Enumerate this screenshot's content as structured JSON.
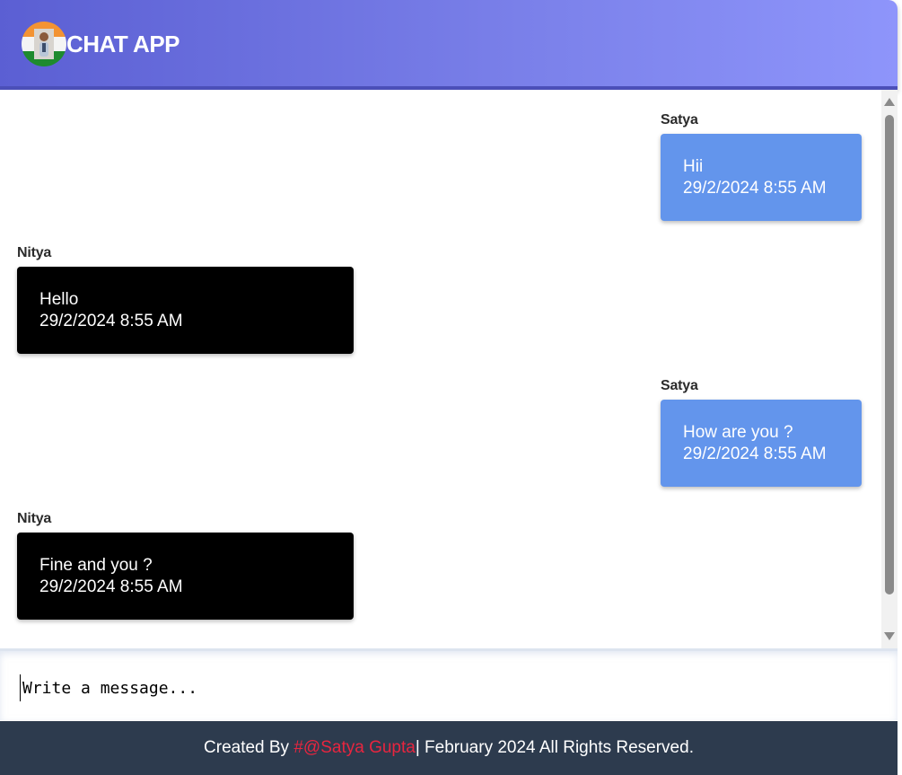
{
  "header": {
    "title": "CHAT APP",
    "avatar_icon": "user-avatar-flag-icon"
  },
  "messages": [
    {
      "sender": "Satya",
      "text": "Hii",
      "time": "29/2/2024 8:55 AM",
      "direction": "outgoing"
    },
    {
      "sender": "Nitya",
      "text": "Hello",
      "time": "29/2/2024 8:55 AM",
      "direction": "incoming"
    },
    {
      "sender": "Satya",
      "text": "How are you ?",
      "time": "29/2/2024 8:55 AM",
      "direction": "outgoing"
    },
    {
      "sender": "Nitya",
      "text": "Fine and you ?",
      "time": "29/2/2024 8:55 AM",
      "direction": "incoming"
    }
  ],
  "composer": {
    "placeholder": "Write a message...",
    "value": ""
  },
  "footer": {
    "prefix": "Created By ",
    "link_text": "#@Satya Gupta",
    "suffix": "| February 2024 All Rights Reserved."
  },
  "colors": {
    "header_start": "#5b5fd3",
    "header_end": "#8e95fb",
    "outgoing_bubble": "#6395ec",
    "incoming_bubble": "#000000",
    "footer_bg": "#2d3b4e",
    "footer_link": "#e8253f"
  }
}
